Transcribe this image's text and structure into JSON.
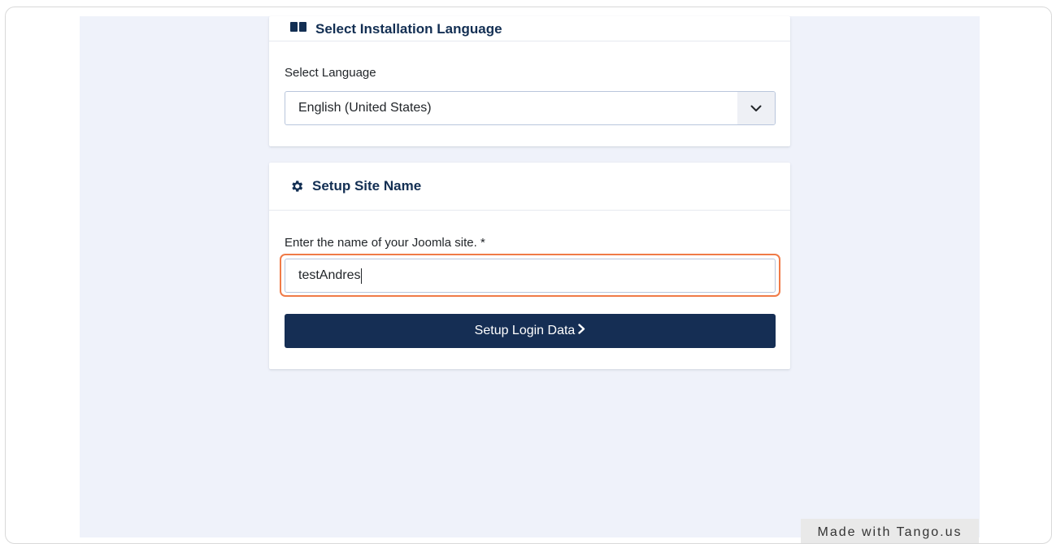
{
  "language_card": {
    "title": "Select Installation Language",
    "field_label": "Select Language",
    "selected_value": "English (United States)"
  },
  "site_card": {
    "title": "Setup Site Name",
    "field_label": "Enter the name of your Joomla site. *",
    "input_value": "testAndres",
    "button_label": "Setup Login Data"
  },
  "watermark": {
    "text": "Made with Tango.us"
  },
  "colors": {
    "page_background": "#eff2fa",
    "primary": "#152e54",
    "heading": "#132f53",
    "highlight": "#f07b48"
  },
  "icons": {
    "language_card": "language-icon",
    "site_card": "gear-icon",
    "select": "chevron-down-icon",
    "button": "chevron-right-icon"
  }
}
